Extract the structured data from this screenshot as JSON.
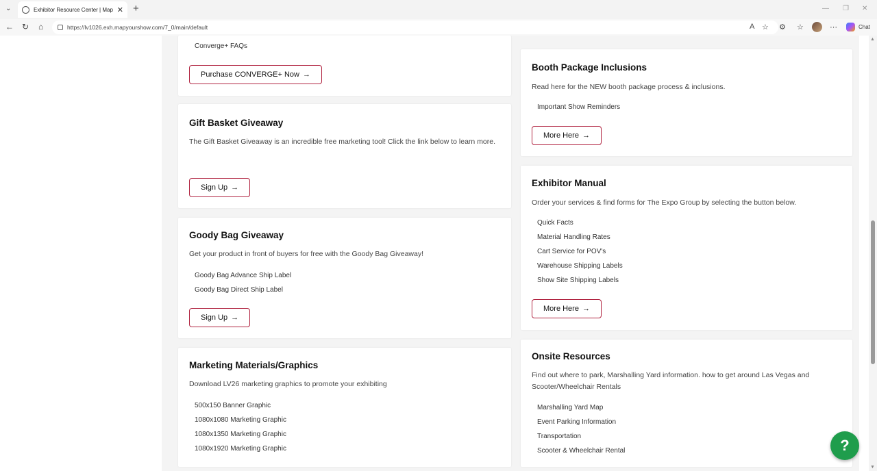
{
  "browser": {
    "tab_title": "Exhibitor Resource Center | Map Y",
    "url": "https://lv1026.exh.mapyourshow.com/7_0/main/default",
    "chat_label": "Chat"
  },
  "left_column": {
    "converge": {
      "link": "Converge+ FAQs",
      "button": "Purchase CONVERGE+ Now"
    },
    "gift_basket": {
      "title": "Gift Basket Giveaway",
      "desc": "The Gift Basket Giveaway is an incredible free marketing tool! Click the link below to learn more.",
      "button": "Sign Up"
    },
    "goody_bag": {
      "title": "Goody Bag Giveaway",
      "desc": "Get your product in front of buyers for free with the Goody Bag Giveaway!",
      "links": [
        "Goody Bag Advance Ship Label",
        "Goody Bag Direct Ship Label"
      ],
      "button": "Sign Up"
    },
    "marketing": {
      "title": "Marketing Materials/Graphics",
      "desc": "Download LV26 marketing graphics to promote your exhibiting",
      "links": [
        "500x150 Banner Graphic",
        "1080x1080 Marketing Graphic",
        "1080x1350 Marketing Graphic",
        "1080x1920 Marketing Graphic"
      ]
    }
  },
  "right_column": {
    "booth": {
      "title": "Booth Package Inclusions",
      "desc": "Read here for the NEW booth package process & inclusions.",
      "links": [
        "Important Show Reminders"
      ],
      "button": "More Here"
    },
    "manual": {
      "title": "Exhibitor Manual",
      "desc": "Order your services & find forms for The Expo Group by selecting the button below.",
      "links": [
        "Quick Facts",
        "Material Handling Rates",
        "Cart Service for POV's",
        "Warehouse Shipping Labels",
        "Show Site Shipping Labels"
      ],
      "button": "More Here"
    },
    "onsite": {
      "title": "Onsite Resources",
      "desc": "Find out where to park, Marshalling Yard information. how to get around Las Vegas and Scooter/Wheelchair Rentals",
      "links": [
        "Marshalling Yard Map",
        "Event Parking Information",
        "Transportation",
        "Scooter & Wheelchair Rental"
      ]
    }
  },
  "arrow_glyph": "→",
  "help_label": "?",
  "colors": {
    "button_border": "#b0223f",
    "help_bg": "#1f9d4c"
  }
}
